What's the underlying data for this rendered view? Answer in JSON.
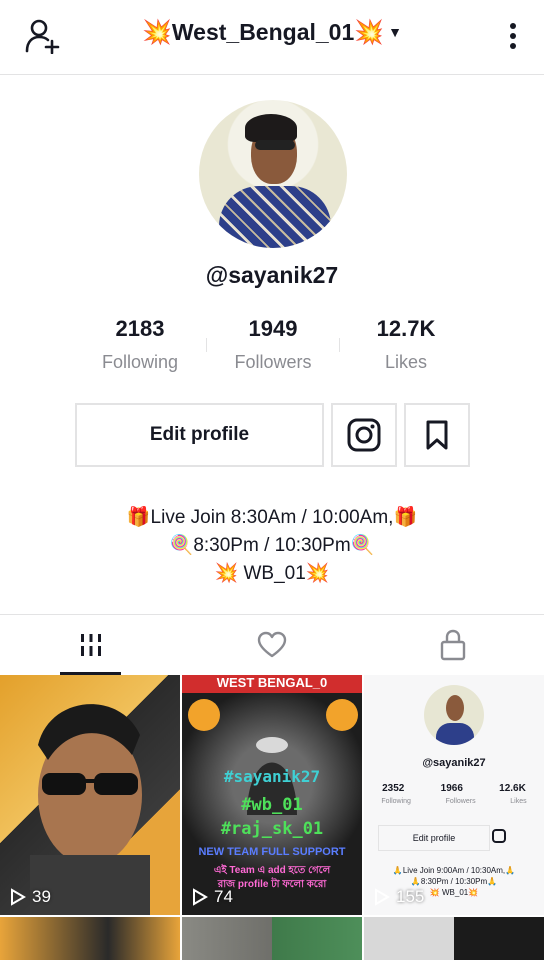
{
  "header": {
    "burst_left": "💥",
    "title": "West_Bengal_01",
    "burst_right": "💥",
    "caret": "▼",
    "add_user_icon": "person-plus-icon",
    "menu_icon": "vertical-dots-icon"
  },
  "profile": {
    "username": "@sayanik27",
    "avatar": "profile-photo"
  },
  "stats": [
    {
      "value": "2183",
      "label": "Following"
    },
    {
      "value": "1949",
      "label": "Followers"
    },
    {
      "value": "12.7K",
      "label": "Likes"
    }
  ],
  "actions": {
    "edit_label": "Edit profile",
    "instagram_icon": "instagram-icon",
    "bookmark_icon": "bookmark-icon"
  },
  "bio": {
    "line1": "🎁Live Join 8:30Am / 10:00Am,🎁",
    "line2": "🍭8:30Pm / 10:30Pm🍭",
    "line3": "💥 WB_01💥"
  },
  "tabs": [
    {
      "name": "videos",
      "icon": "grid-bars-icon",
      "active": true
    },
    {
      "name": "liked",
      "icon": "heart-icon",
      "active": false
    },
    {
      "name": "private",
      "icon": "lock-icon",
      "active": false
    }
  ],
  "videos": [
    {
      "views": "39"
    },
    {
      "views": "74",
      "banner": "WEST BENGAL_0",
      "overlay": [
        "#sayanik27",
        "#wb_01",
        "#raj_sk_01",
        "NEW TEAM FULL SUPPORT",
        "এই Team এ add হতে গেলে",
        "রাজ profile টা ফলো করো"
      ]
    },
    {
      "views": "155",
      "mini_username": "@sayanik27",
      "mini_stats": [
        "2352",
        "1966",
        "12.6K"
      ],
      "mini_labels": [
        "Following",
        "Followers",
        "Likes"
      ],
      "mini_edit": "Edit profile",
      "mini_bio": [
        "🙏Live Join 9:00Am / 10:30Am,🙏",
        "🙏8:30Pm / 10:30Pm🙏",
        "💥 WB_01💥"
      ]
    }
  ],
  "colors": {
    "text": "#161823",
    "muted": "#8a8b91",
    "border": "#e3e3e4",
    "accent": "#fe2c55"
  }
}
